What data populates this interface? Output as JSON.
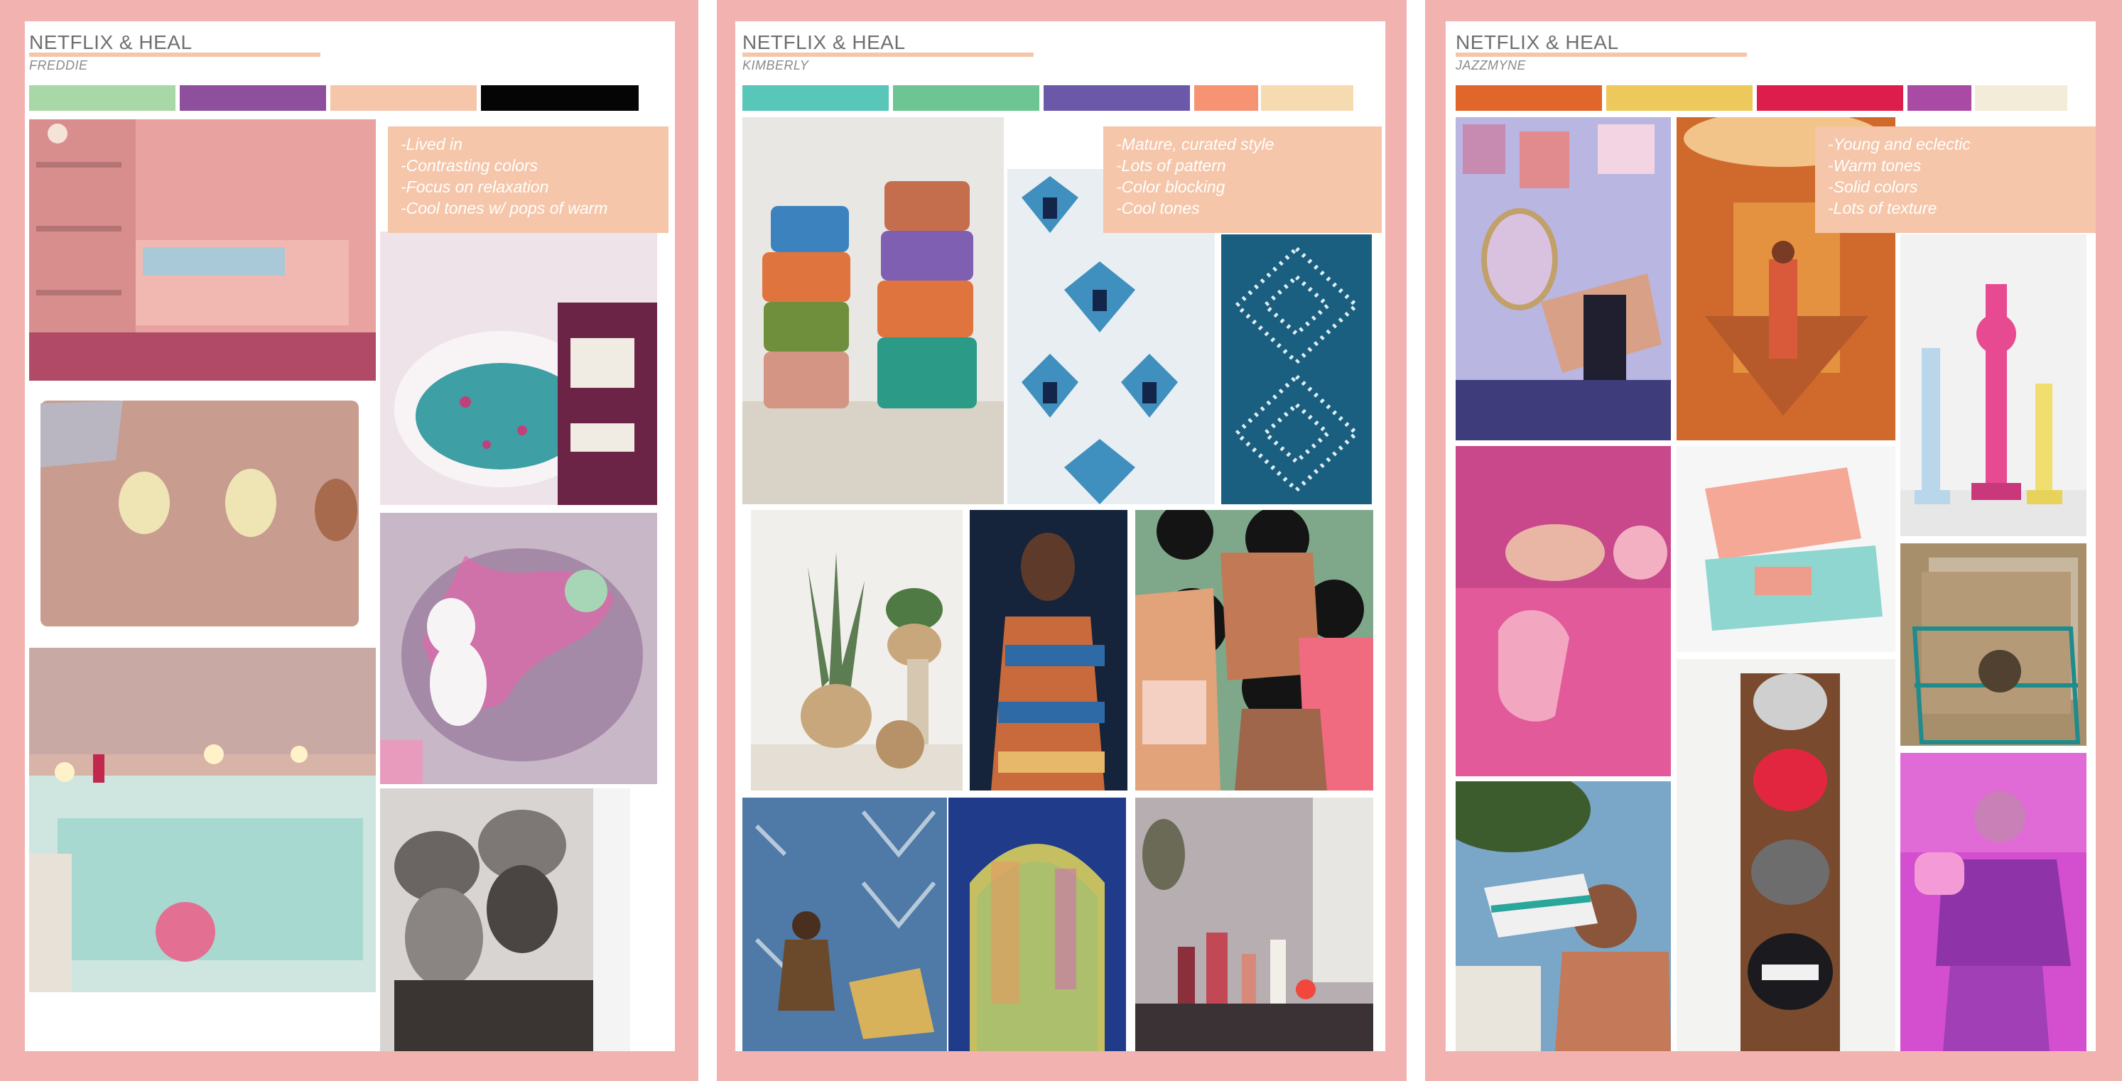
{
  "boards": [
    {
      "brand": "NETFLIX & HEAL",
      "person": "FREDDIE",
      "palette": [
        "#a8d8a8",
        "#8e4f9c",
        "#f5c6a9",
        "#050505"
      ],
      "notes": [
        "-Lived in",
        "-Contrasting colors",
        "-Focus on relaxation",
        "-Cool tones w/ pops of warm"
      ]
    },
    {
      "brand": "NETFLIX & HEAL",
      "person": "KIMBERLY",
      "palette": [
        "#58c6b8",
        "#6cc592",
        "#6c58a8",
        "#f59372",
        "#f6dbb1"
      ],
      "notes": [
        "-Mature, curated style",
        "-Lots of pattern",
        "-Color blocking",
        "-Cool tones"
      ]
    },
    {
      "brand": "NETFLIX & HEAL",
      "person": "JAZZMYNE",
      "palette": [
        "#e1662b",
        "#ecc95a",
        "#dd1e4c",
        "#a94aa4",
        "#f3ecd9"
      ],
      "notes": [
        "-Young and eclectic",
        "-Warm tones",
        "-Solid colors",
        "-Lots of texture"
      ]
    }
  ]
}
